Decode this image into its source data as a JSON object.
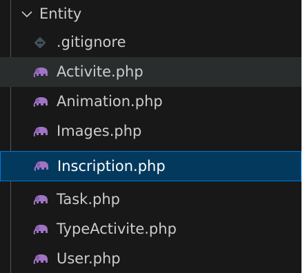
{
  "explorer": {
    "folder": {
      "label": "Entity",
      "expanded": true,
      "icon": "chevron-down-icon"
    },
    "files": [
      {
        "label": ".gitignore",
        "icon": "gitignore-icon",
        "state": "normal"
      },
      {
        "label": "Activite.php",
        "icon": "php-elephant-icon",
        "state": "hovered"
      },
      {
        "label": "Animation.php",
        "icon": "php-elephant-icon",
        "state": "normal"
      },
      {
        "label": "Images.php",
        "icon": "php-elephant-icon",
        "state": "normal"
      },
      {
        "label": "Inscription.php",
        "icon": "php-elephant-icon",
        "state": "selected"
      },
      {
        "label": "Task.php",
        "icon": "php-elephant-icon",
        "state": "normal"
      },
      {
        "label": "TypeActivite.php",
        "icon": "php-elephant-icon",
        "state": "normal"
      },
      {
        "label": "User.php",
        "icon": "php-elephant-icon",
        "state": "normal"
      }
    ]
  },
  "colors": {
    "background": "#181818",
    "text": "#cccccc",
    "selected_background": "#04395e",
    "selected_border": "#0078d4",
    "hover_background": "#2a2d2e",
    "php_icon": "#a074c4",
    "gitignore_icon": "#41535b"
  }
}
